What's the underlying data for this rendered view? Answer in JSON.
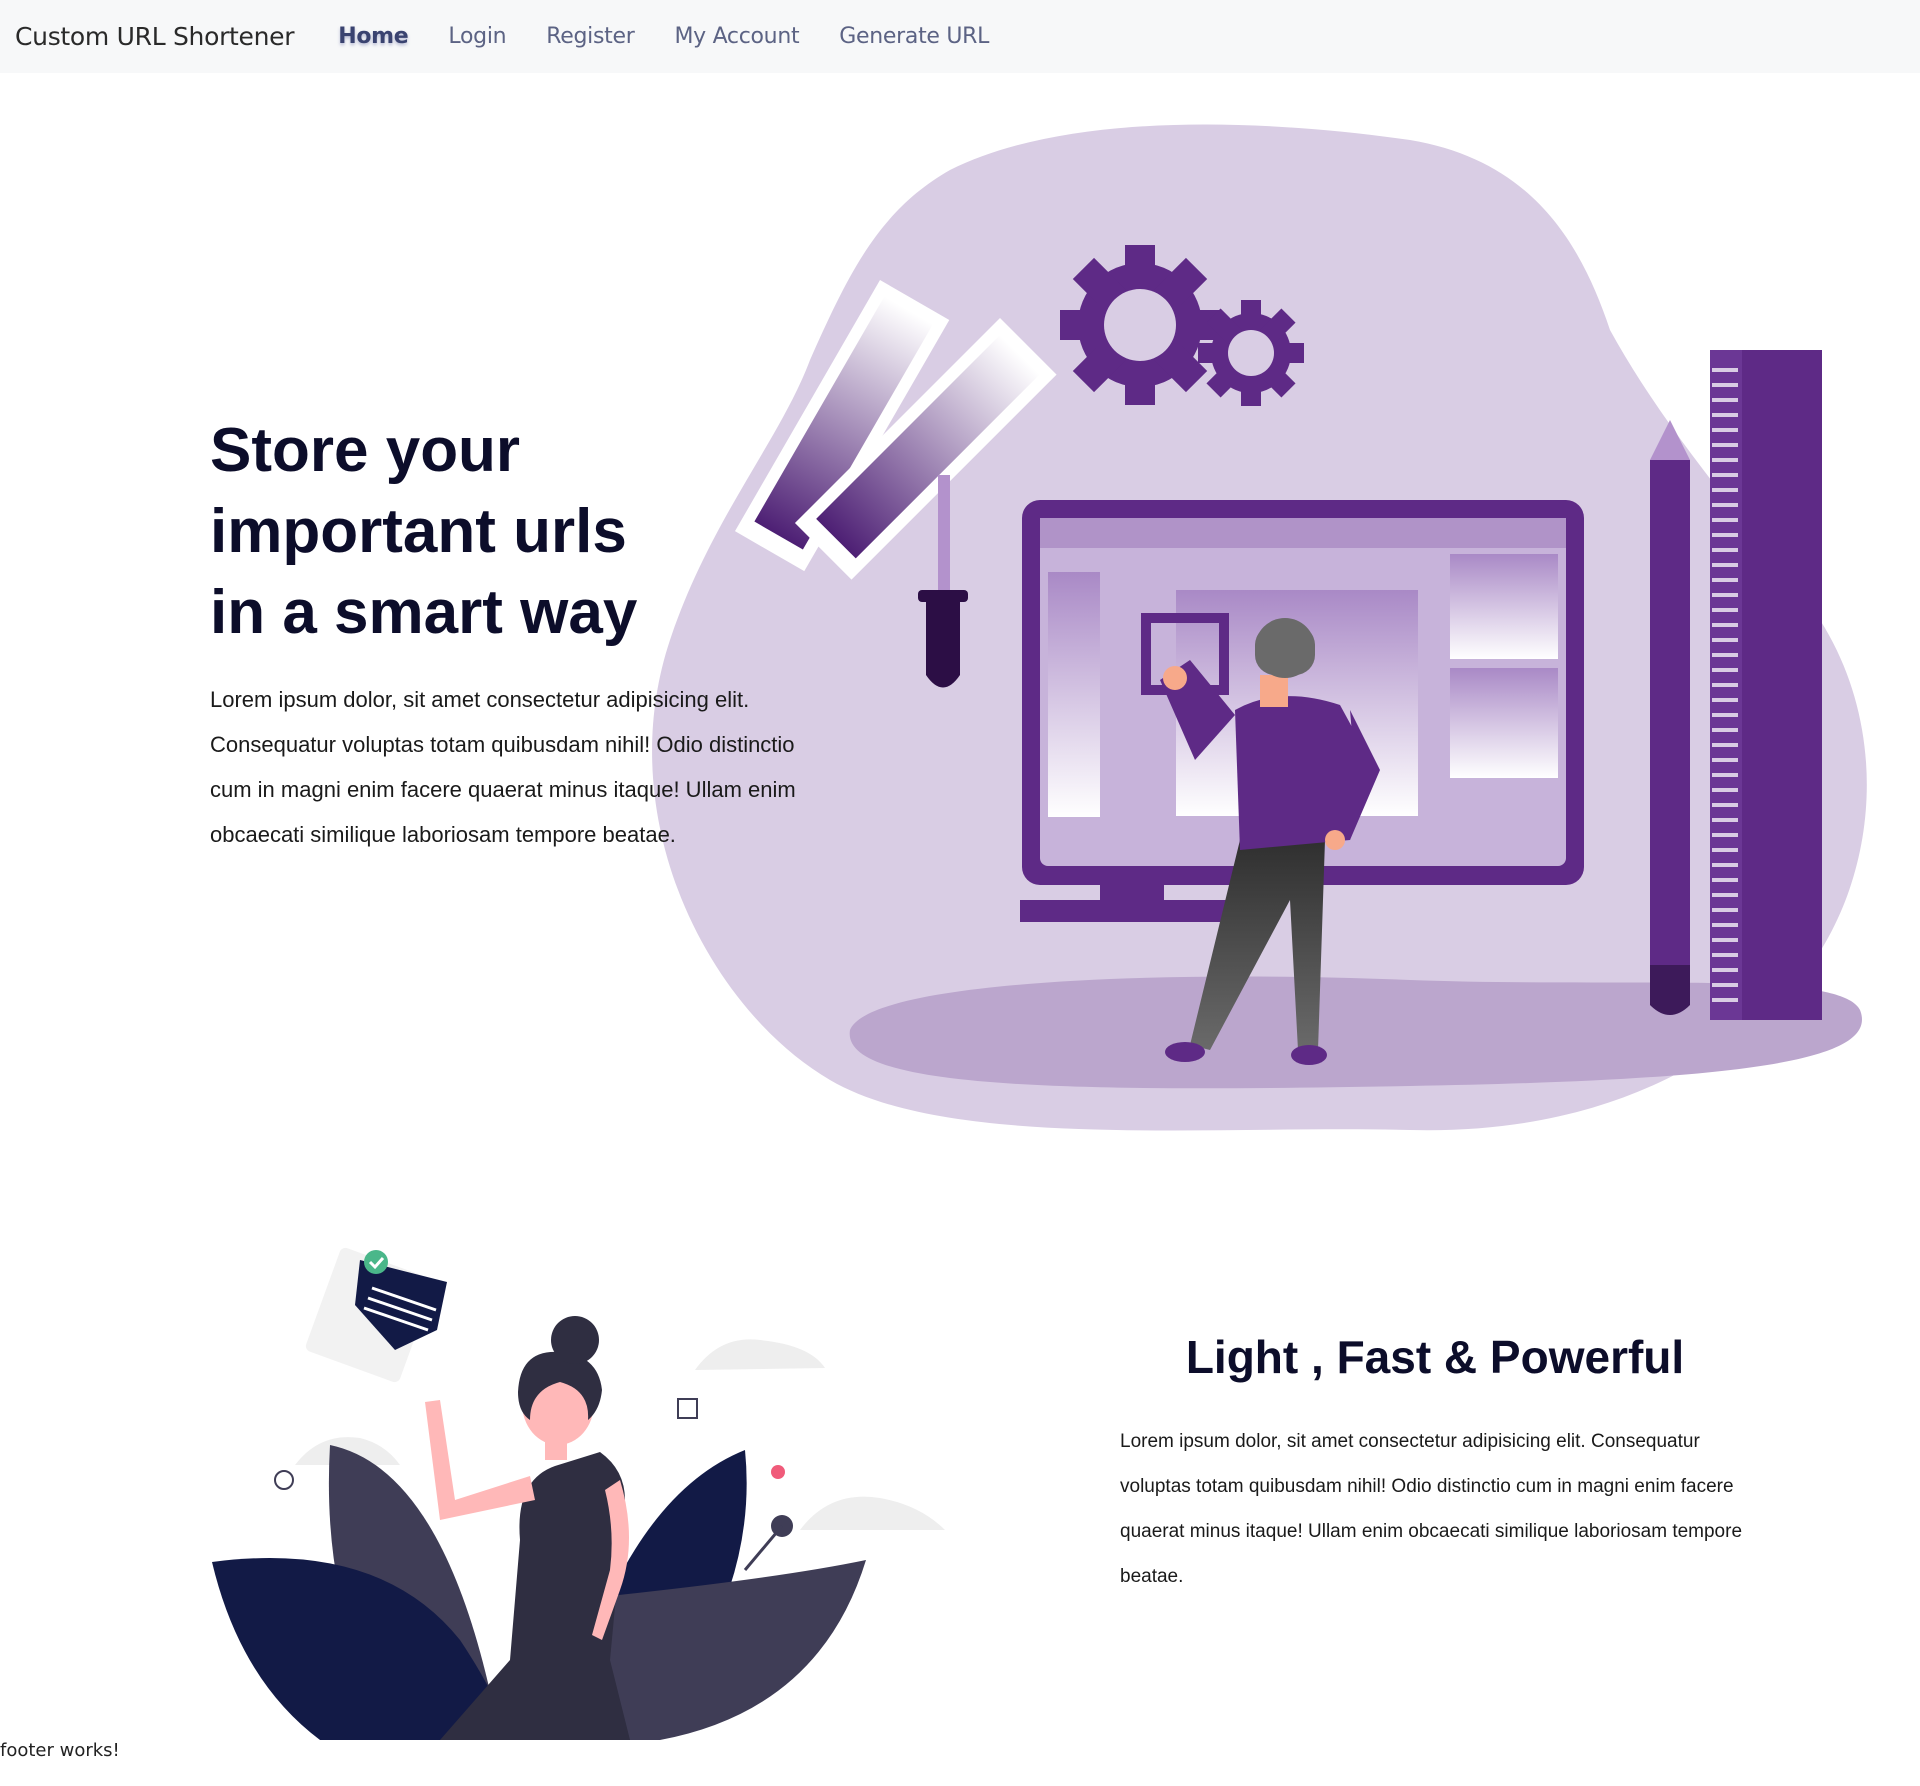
{
  "navbar": {
    "brand": "Custom URL Shortener",
    "links": [
      "Home",
      "Login",
      "Register",
      "My Account",
      "Generate URL"
    ],
    "active": "Home"
  },
  "hero": {
    "title": "Store your\nimportant urls\nin a smart way",
    "paragraph": "Lorem ipsum dolor, sit amet consectetur adipisicing elit. Consequatur voluptas totam quibusdam nihil! Odio distinctio cum in magni enim facere quaerat minus itaque! Ullam enim obcaecati similique laboriosam tempore beatae.",
    "illustration": "designer-at-monitor-illustration"
  },
  "feature": {
    "title": "Light , Fast & Powerful",
    "paragraph": "Lorem ipsum dolor, sit amet consectetur adipisicing elit. Consequatur voluptas totam quibusdam nihil! Odio distinctio cum in magni enim facere quaerat minus itaque! Ullam enim obcaecati similique laboriosam tempore beatae.",
    "illustration": "woman-with-envelope-illustration"
  },
  "footer": {
    "text": "footer works!"
  },
  "colors": {
    "purple": "#5e2a86",
    "lavender": "#d9cde4",
    "navy": "#121a46",
    "nav_bg": "#f7f8f9"
  }
}
